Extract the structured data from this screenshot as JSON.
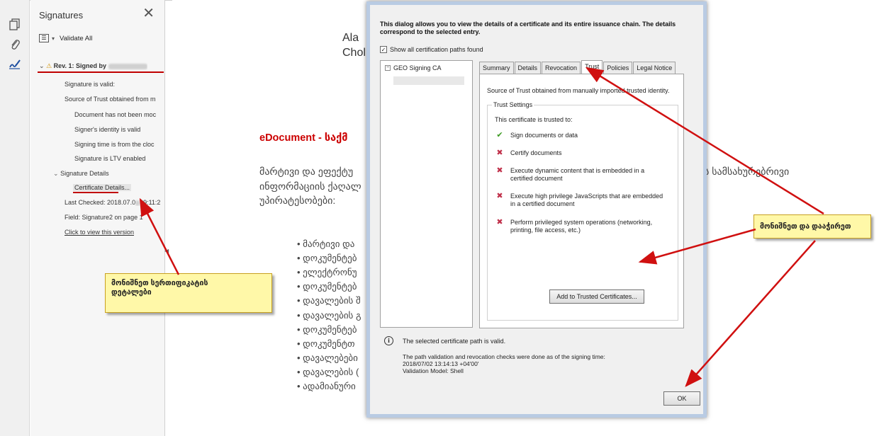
{
  "rail": {
    "icons": [
      "pages-icon",
      "paperclip-icon",
      "signature-pen-icon"
    ]
  },
  "signatures_panel": {
    "title": "Signatures",
    "validate_all": "Validate All",
    "revision": "Rev. 1: Signed by",
    "items": [
      "Signature is valid:",
      "Source of Trust obtained from m",
      "Document has not been moc",
      "Signer's identity is valid",
      "Signing time is from the cloc",
      "Signature is LTV enabled",
      "Signature Details",
      "Certificate Details...",
      "Last Checked: 2018.07.0",
      "09:11:2",
      "Field: Signature2 on page 1",
      "Click to view this version"
    ]
  },
  "document": {
    "name_line1": "Ala",
    "name_line2": "Chol",
    "heading": "eDocument - საქმ",
    "para_line1": "მარტივი და ეფექტუ",
    "para_line1_right": "ს სამსახურებრივი",
    "para_line2": "ინფორმაციის ქაღალ",
    "para_line3": "უპირატესობები:",
    "bullets": [
      "• მარტივი და",
      "• დოკუმენტებ",
      "• ელექტრონუ",
      "• დოკუმენტებ",
      "• დავალების შ",
      "• დავალების გ",
      "• დოკუმენტებ",
      "• დოკუმენტთ",
      "• დავალებები",
      "• დავალების (",
      "• ადამიანური"
    ]
  },
  "dialog": {
    "intro": "This dialog allows you to view the details of a certificate and its entire issuance chain. The details correspond to the selected entry.",
    "show_all_paths": "Show all certification paths found",
    "path_root": "GEO Signing CA",
    "tabs": [
      "Summary",
      "Details",
      "Revocation",
      "Trust",
      "Policies",
      "Legal Notice"
    ],
    "active_tab": "Trust",
    "trust_source": "Source of Trust obtained from manually imported trusted identity.",
    "trust_settings_label": "Trust Settings",
    "trusted_to": "This certificate is trusted to:",
    "permissions": [
      {
        "text": "Sign documents or data",
        "allowed": true
      },
      {
        "text": "Certify documents",
        "allowed": false
      },
      {
        "text": "Execute dynamic content that is embedded in a certified document",
        "allowed": false
      },
      {
        "text": "Execute high privilege JavaScripts that are embedded in a certified document",
        "allowed": false
      },
      {
        "text": "Perform privileged system operations (networking, printing, file access, etc.)",
        "allowed": false
      }
    ],
    "add_trusted_button": "Add to Trusted Certificates...",
    "status_line": "The selected certificate path is valid.",
    "validation_line1": "The path validation and revocation checks were done as of the signing time:",
    "validation_line2": "2018/07/02 13:14:13 +04'00'",
    "validation_line3": "Validation Model: Shell",
    "ok_button": "OK"
  },
  "annotations": {
    "note_left_line1": "მონიშნეთ სერთიფიკატის",
    "note_left_line2": "დეტალები",
    "note_right": "მონიშნეთ და დააჭირეთ"
  },
  "colors": {
    "annotation_red": "#cc0000",
    "note_yellow": "#fff8a8",
    "check_green": "#3a9a20",
    "cross_red": "#c0304a",
    "dialog_frame": "#b9cbe3"
  }
}
